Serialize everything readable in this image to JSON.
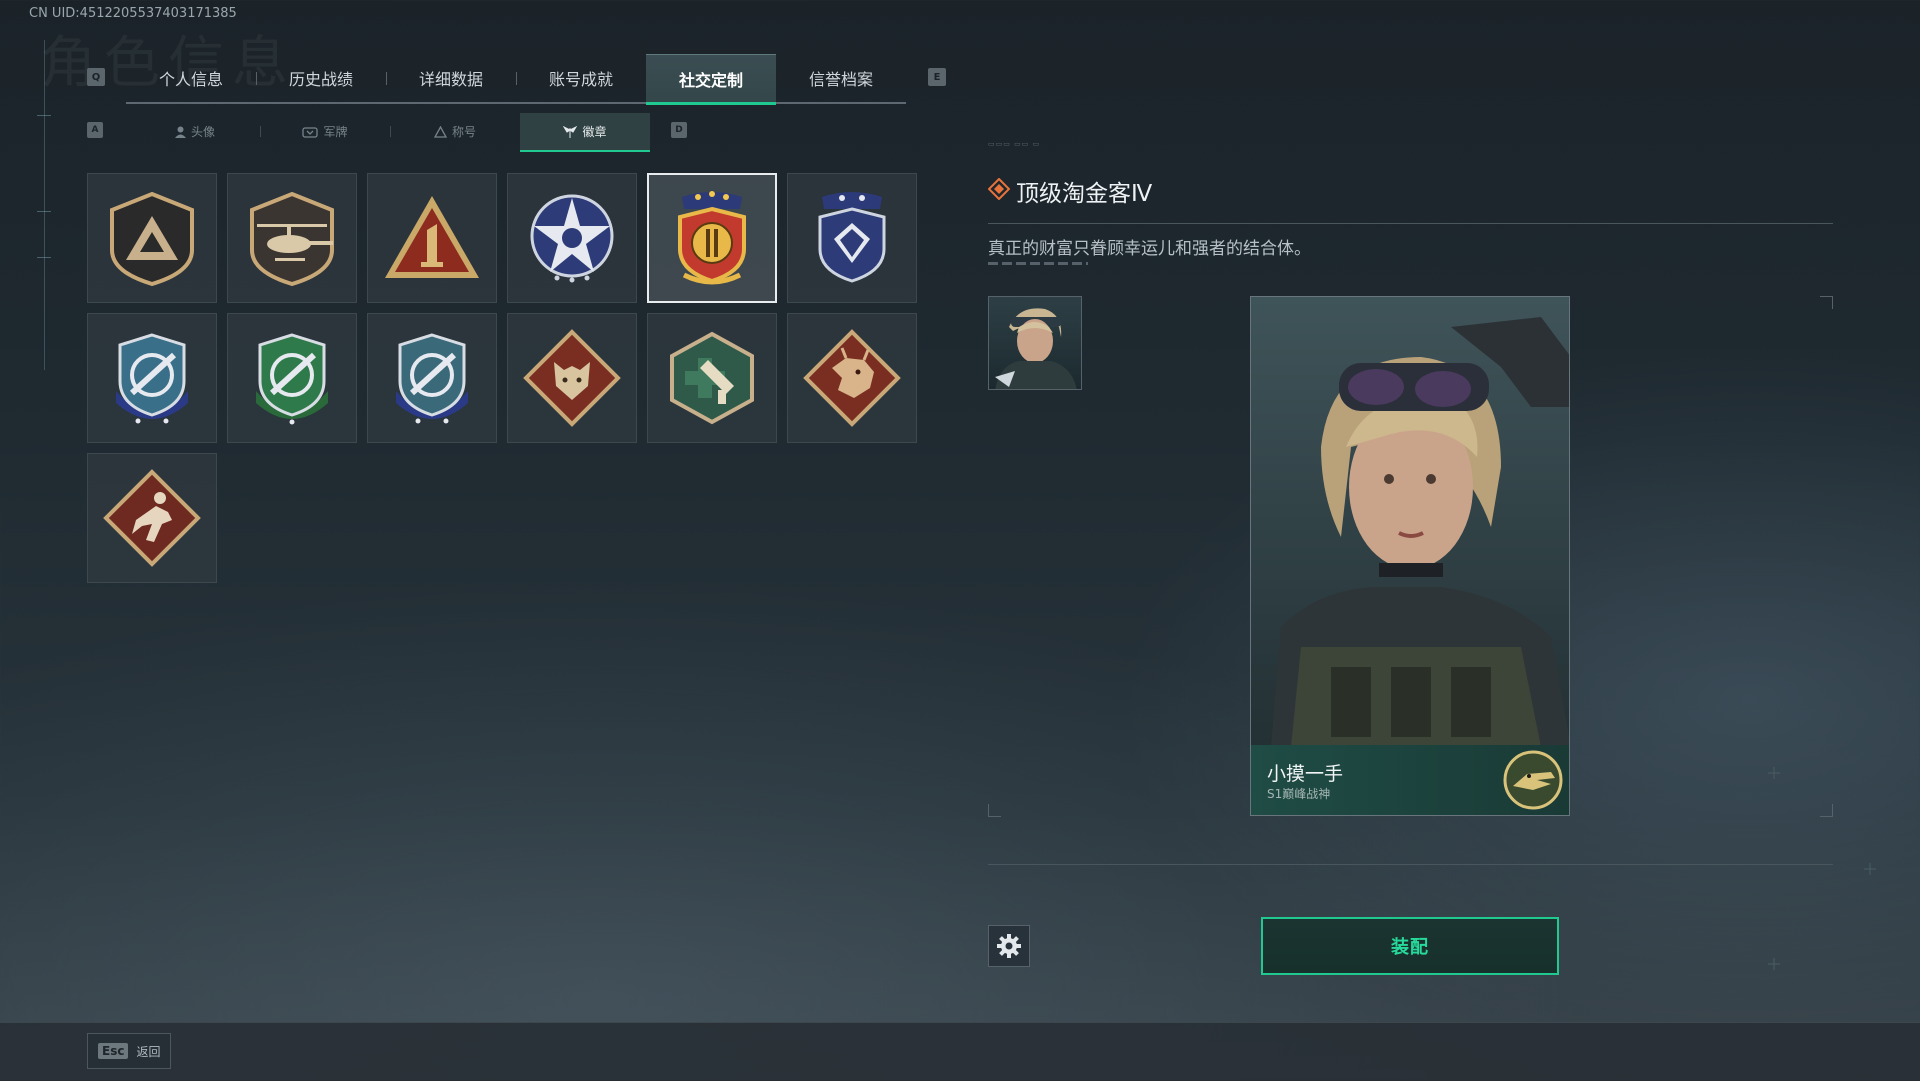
{
  "header": {
    "uid_text": "CN UID:4512205537403171385",
    "ghost_title": "角色信息",
    "left_key": "Q",
    "right_key": "E"
  },
  "tabs": [
    {
      "label": "个人信息",
      "active": false
    },
    {
      "label": "历史战绩",
      "active": false
    },
    {
      "label": "详细数据",
      "active": false
    },
    {
      "label": "账号成就",
      "active": false
    },
    {
      "label": "社交定制",
      "active": true
    },
    {
      "label": "信誉档案",
      "active": false
    }
  ],
  "subtabs": {
    "left_key": "A",
    "right_key": "D",
    "items": [
      {
        "label": "头像",
        "icon": "person-icon",
        "active": false
      },
      {
        "label": "军牌",
        "icon": "dogtag-icon",
        "active": false
      },
      {
        "label": "称号",
        "icon": "triangle-icon",
        "active": false
      },
      {
        "label": "徽章",
        "icon": "wings-icon",
        "active": true
      }
    ]
  },
  "badges": [
    {
      "name": "triangle-shield",
      "selected": false
    },
    {
      "name": "helicopter-shield",
      "selected": false
    },
    {
      "name": "number-one-triangle",
      "selected": false
    },
    {
      "name": "star-emblem",
      "selected": false
    },
    {
      "name": "gold-crest",
      "selected": true
    },
    {
      "name": "diamond-shield",
      "selected": false
    },
    {
      "name": "blue-sniper-crest",
      "selected": false
    },
    {
      "name": "green-sniper-crest",
      "selected": false
    },
    {
      "name": "navy-sniper-crest",
      "selected": false
    },
    {
      "name": "wolf-diamond",
      "selected": false
    },
    {
      "name": "medic-hexagon",
      "selected": false
    },
    {
      "name": "dragon-diamond",
      "selected": false
    },
    {
      "name": "runner-diamond",
      "selected": false
    }
  ],
  "detail": {
    "title": "顶级淘金客Ⅳ",
    "description": "真正的财富只眷顾幸运儿和强者的结合体。"
  },
  "card": {
    "player_name": "小摸一手",
    "player_title": "S1巅峰战神"
  },
  "actions": {
    "equip_label": "装配",
    "settings_icon": "gear-icon"
  },
  "footer": {
    "esc_key": "Esc",
    "back_label": "返回"
  },
  "colors": {
    "accent": "#1fc98f",
    "title_icon": "#e8733a"
  }
}
